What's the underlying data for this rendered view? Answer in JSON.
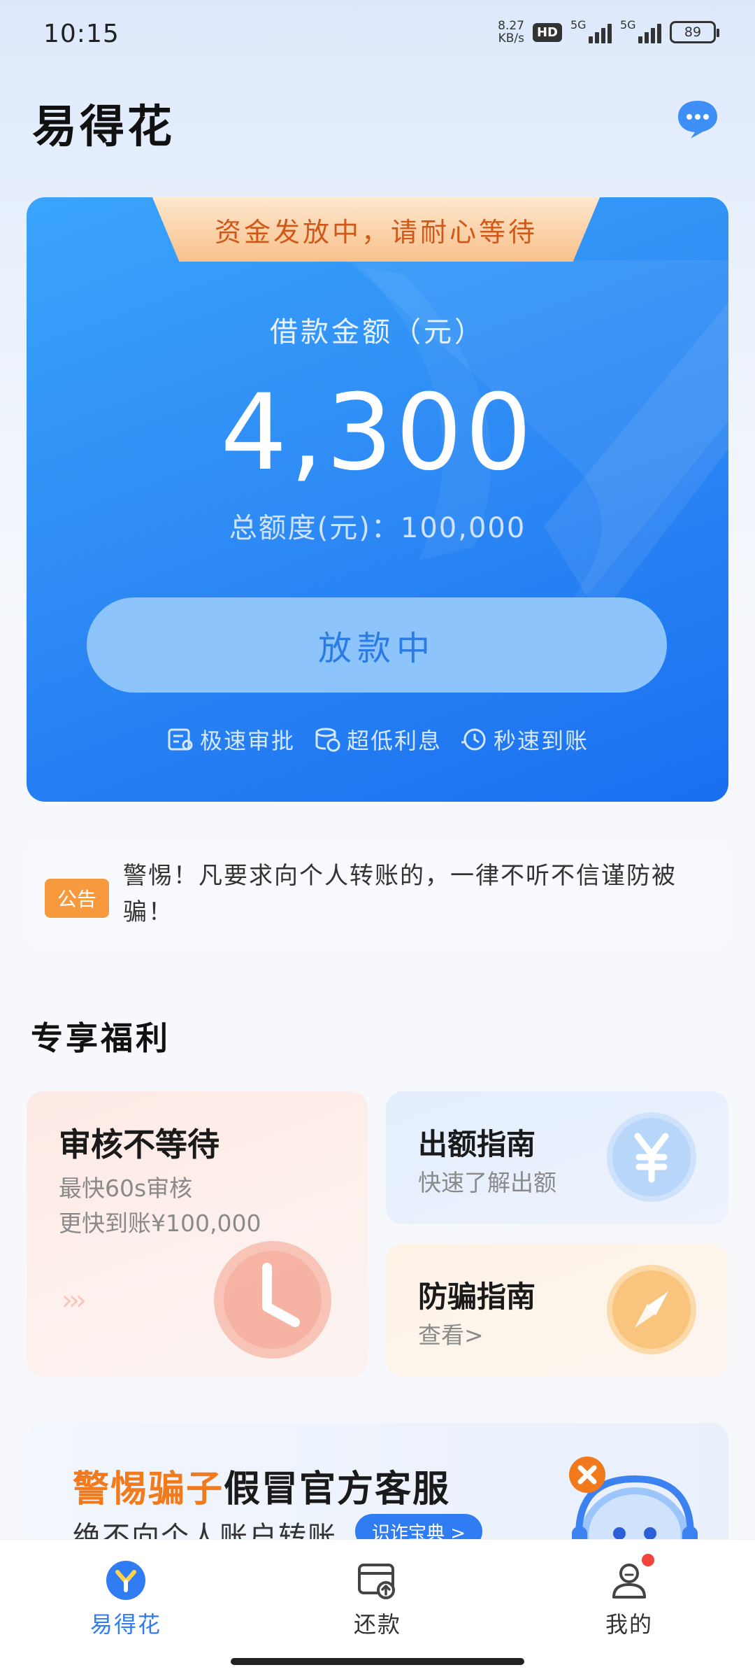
{
  "status_bar": {
    "time": "10:15",
    "net_speed_value": "8.27",
    "net_speed_unit": "KB/s",
    "hd": "HD",
    "network_1": "5G",
    "network_2": "5G",
    "battery": "89"
  },
  "header": {
    "app_title": "易得花",
    "chat_icon": "customer-service-chat-icon"
  },
  "hero": {
    "banner": "资金发放中，请耐心等待",
    "amount_label": "借款金额（元）",
    "amount": "4,300",
    "total_quota": "总额度(元)：100,000",
    "status_button": "放款中",
    "features": [
      {
        "icon": "approval-icon",
        "label": "极速审批"
      },
      {
        "icon": "coins-icon",
        "label": "超低利息"
      },
      {
        "icon": "clock-icon",
        "label": "秒速到账"
      }
    ],
    "colors": {
      "card_start": "#3aa4fb",
      "card_end": "#1a6ff0",
      "banner_text": "#d0591a"
    }
  },
  "notice": {
    "tag": "公告",
    "text": "警惕！凡要求向个人转账的，一律不听不信谨防被骗！"
  },
  "benefits": {
    "title": "专享福利",
    "review_card": {
      "title": "审核不等待",
      "sub1": "最快60s审核",
      "sub2": "更快到账¥100,000",
      "icon": "clock-icon"
    },
    "quota_card": {
      "title": "出额指南",
      "sub": "快速了解出额",
      "icon": "yen-icon"
    },
    "fraud_card": {
      "title": "防骗指南",
      "sub": "查看>",
      "icon": "compass-icon"
    }
  },
  "promo": {
    "warn": "警惕骗子",
    "rest": "假冒官方客服",
    "line2": "绝不向个人账户转账",
    "button": "识诈宝典 >",
    "mascot": "robot-mascot-icon"
  },
  "tabbar": {
    "items": [
      {
        "label": "易得花",
        "icon": "home-logo-icon",
        "active": true
      },
      {
        "label": "还款",
        "icon": "repay-card-icon",
        "active": false
      },
      {
        "label": "我的",
        "icon": "profile-icon",
        "active": false
      }
    ],
    "accent": "#2f7cf3"
  }
}
